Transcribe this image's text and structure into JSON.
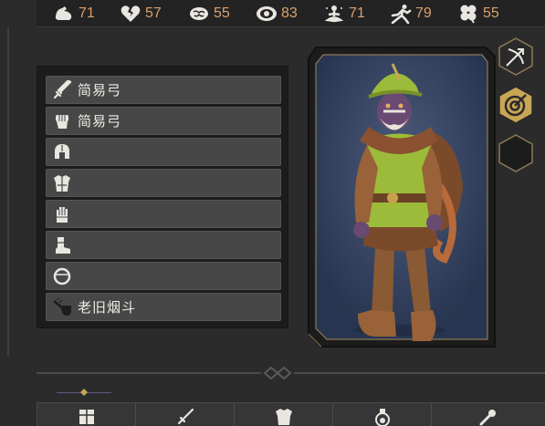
{
  "stats": [
    {
      "icon": "strength-icon",
      "value": "71"
    },
    {
      "icon": "broken-heart-icon",
      "value": "57"
    },
    {
      "icon": "brain-icon",
      "value": "55"
    },
    {
      "icon": "eye-icon",
      "value": "83"
    },
    {
      "icon": "meditation-icon",
      "value": "71"
    },
    {
      "icon": "running-icon",
      "value": "79"
    },
    {
      "icon": "clover-icon",
      "value": "55"
    }
  ],
  "equipment": [
    {
      "slot": "weapon",
      "icon": "sword-icon",
      "label": "简易弓"
    },
    {
      "slot": "offhand",
      "icon": "fist-icon",
      "label": "简易弓"
    },
    {
      "slot": "head",
      "icon": "helmet-icon",
      "label": ""
    },
    {
      "slot": "body",
      "icon": "armor-icon",
      "label": ""
    },
    {
      "slot": "hands",
      "icon": "gauntlet-icon",
      "label": ""
    },
    {
      "slot": "feet",
      "icon": "boot-icon",
      "label": ""
    },
    {
      "slot": "ring",
      "icon": "ring-icon",
      "label": ""
    },
    {
      "slot": "trinket",
      "icon": "pipe-icon",
      "label": "老旧烟斗"
    }
  ],
  "side_buttons": [
    "bow-target-icon",
    "archery-target-icon",
    "empty-slot"
  ],
  "tabs": [
    "armor-tab-icon",
    "sword-tab-icon",
    "chestplate-tab-icon",
    "potion-tab-icon",
    "scepter-tab-icon"
  ],
  "colors": {
    "stat_value": "#d9a06b",
    "slot_bg": "#474748",
    "accent_gold": "#c9a655"
  }
}
